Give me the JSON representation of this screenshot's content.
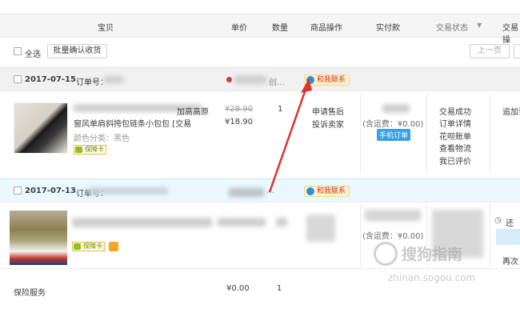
{
  "header": {
    "col_item": "宝贝",
    "col_price": "单价",
    "col_qty": "数量",
    "col_ops": "商品操作",
    "col_paid": "实付款",
    "col_status": "交易状态",
    "col_status_arrow": "▼",
    "col_trade": "交易操"
  },
  "toolbar": {
    "select_all": "全选",
    "batch_confirm": "批量确认收货",
    "prev_page": "上一页"
  },
  "orders": [
    {
      "date": "2017-07-15",
      "order_no_label": "订单号：",
      "contact": "和我联系",
      "title_line1": "加高高原",
      "title_line2": "窗风单肩斜挎包链条小包包 [交易",
      "color_spec": "颜色分类：黑色",
      "guarantee": "保障卡",
      "original_price": "¥28.90",
      "price": "¥18.90",
      "qty": "1",
      "op_after_sale": "申请售后",
      "op_complain": "投诉卖家",
      "shipping": "(含运费：¥0.00)",
      "phone_order": "手机订单",
      "status_lines": [
        "交易成功",
        "订单详情",
        "花呗账单",
        "查看物流",
        "我已评价"
      ],
      "trade_op": "追加评"
    },
    {
      "date": "2017-07-13",
      "order_no_label": "订单号：",
      "contact": "和我联系",
      "guarantee": "保障卡",
      "shipping": "(含运费：¥0.00)",
      "trade_op_1": "还",
      "trade_op_2": "再次",
      "insurance_label": "保险服务",
      "insurance_price": "¥0.00",
      "insurance_qty": "1"
    }
  ],
  "watermark": {
    "brand": "搜狗指南",
    "url": "zhinan.sogou.com"
  },
  "colors": {
    "accent_blue": "#2d8fdb",
    "header_bg": "#f5f5f5",
    "order2_bg": "#eaf8ff",
    "arrow_red": "#e0312c"
  }
}
